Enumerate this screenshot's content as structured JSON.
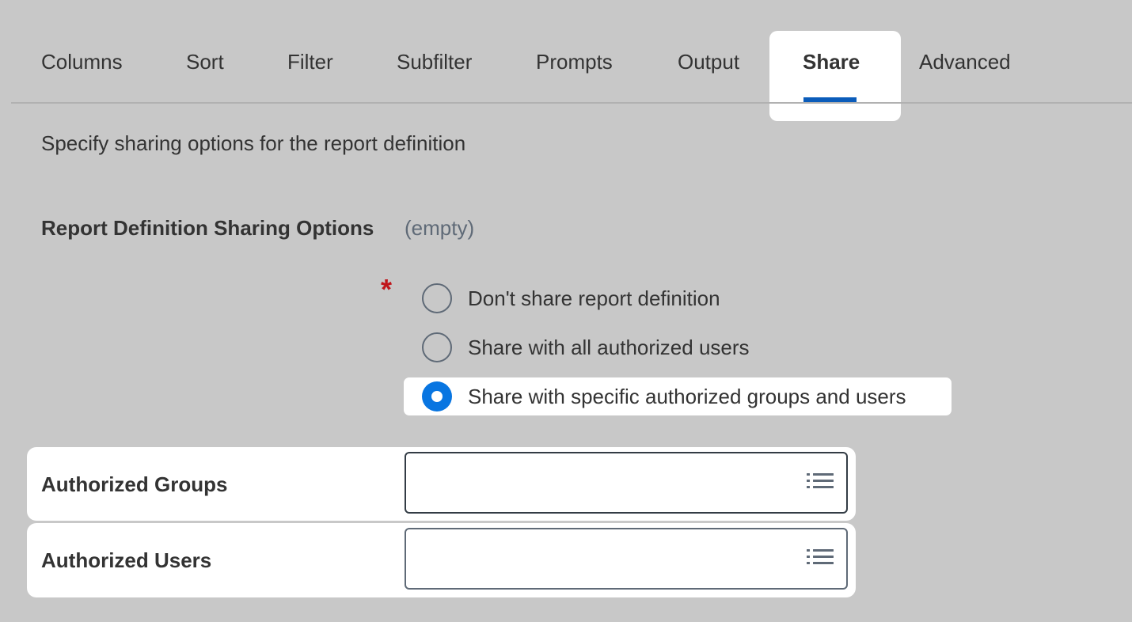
{
  "tabs": [
    {
      "label": "Columns",
      "active": false
    },
    {
      "label": "Sort",
      "active": false
    },
    {
      "label": "Filter",
      "active": false
    },
    {
      "label": "Subfilter",
      "active": false
    },
    {
      "label": "Prompts",
      "active": false
    },
    {
      "label": "Output",
      "active": false
    },
    {
      "label": "Share",
      "active": true
    },
    {
      "label": "Advanced",
      "active": false
    }
  ],
  "description": "Specify sharing options for the report definition",
  "sharing_options": {
    "label": "Report Definition Sharing Options",
    "value": "(empty)",
    "required_marker": "*",
    "options": [
      {
        "label": "Don't share report definition",
        "selected": false
      },
      {
        "label": "Share with all authorized users",
        "selected": false
      },
      {
        "label": "Share with specific authorized groups and users",
        "selected": true
      }
    ]
  },
  "authorized_groups": {
    "label": "Authorized Groups",
    "value": "",
    "icon": "list-icon"
  },
  "authorized_users": {
    "label": "Authorized Users",
    "value": "",
    "icon": "list-icon"
  },
  "colors": {
    "accent": "#0875e1",
    "tab_underline": "#0b5cba",
    "required": "#c0161b",
    "background": "#c8c8c8"
  }
}
